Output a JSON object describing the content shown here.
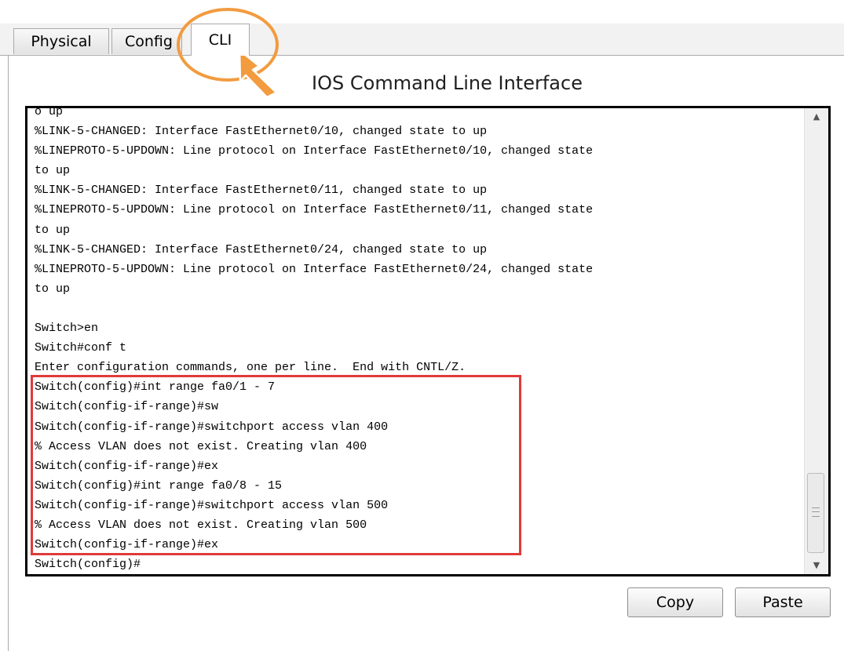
{
  "tabs": [
    {
      "label": "Physical",
      "active": false
    },
    {
      "label": "Config",
      "active": false
    },
    {
      "label": "CLI",
      "active": true
    }
  ],
  "panel": {
    "title": "IOS Command Line Interface"
  },
  "console": {
    "lines": [
      "o up",
      "%LINK-5-CHANGED: Interface FastEthernet0/10, changed state to up",
      "%LINEPROTO-5-UPDOWN: Line protocol on Interface FastEthernet0/10, changed state",
      "to up",
      "%LINK-5-CHANGED: Interface FastEthernet0/11, changed state to up",
      "%LINEPROTO-5-UPDOWN: Line protocol on Interface FastEthernet0/11, changed state",
      "to up",
      "%LINK-5-CHANGED: Interface FastEthernet0/24, changed state to up",
      "%LINEPROTO-5-UPDOWN: Line protocol on Interface FastEthernet0/24, changed state",
      "to up",
      "",
      "Switch>en",
      "Switch#conf t",
      "Enter configuration commands, one per line.  End with CNTL/Z.",
      "Switch(config)#int range fa0/1 - 7",
      "Switch(config-if-range)#sw",
      "Switch(config-if-range)#switchport access vlan 400",
      "% Access VLAN does not exist. Creating vlan 400",
      "Switch(config-if-range)#ex",
      "Switch(config)#int range fa0/8 - 15",
      "Switch(config-if-range)#switchport access vlan 500",
      "% Access VLAN does not exist. Creating vlan 500",
      "Switch(config-if-range)#ex",
      "Switch(config)#"
    ]
  },
  "buttons": {
    "copy": "Copy",
    "paste": "Paste"
  },
  "annotation_colors": {
    "circle": "#f29b3f",
    "arrow": "#f29b3f",
    "highlight": "#e03a3a"
  }
}
